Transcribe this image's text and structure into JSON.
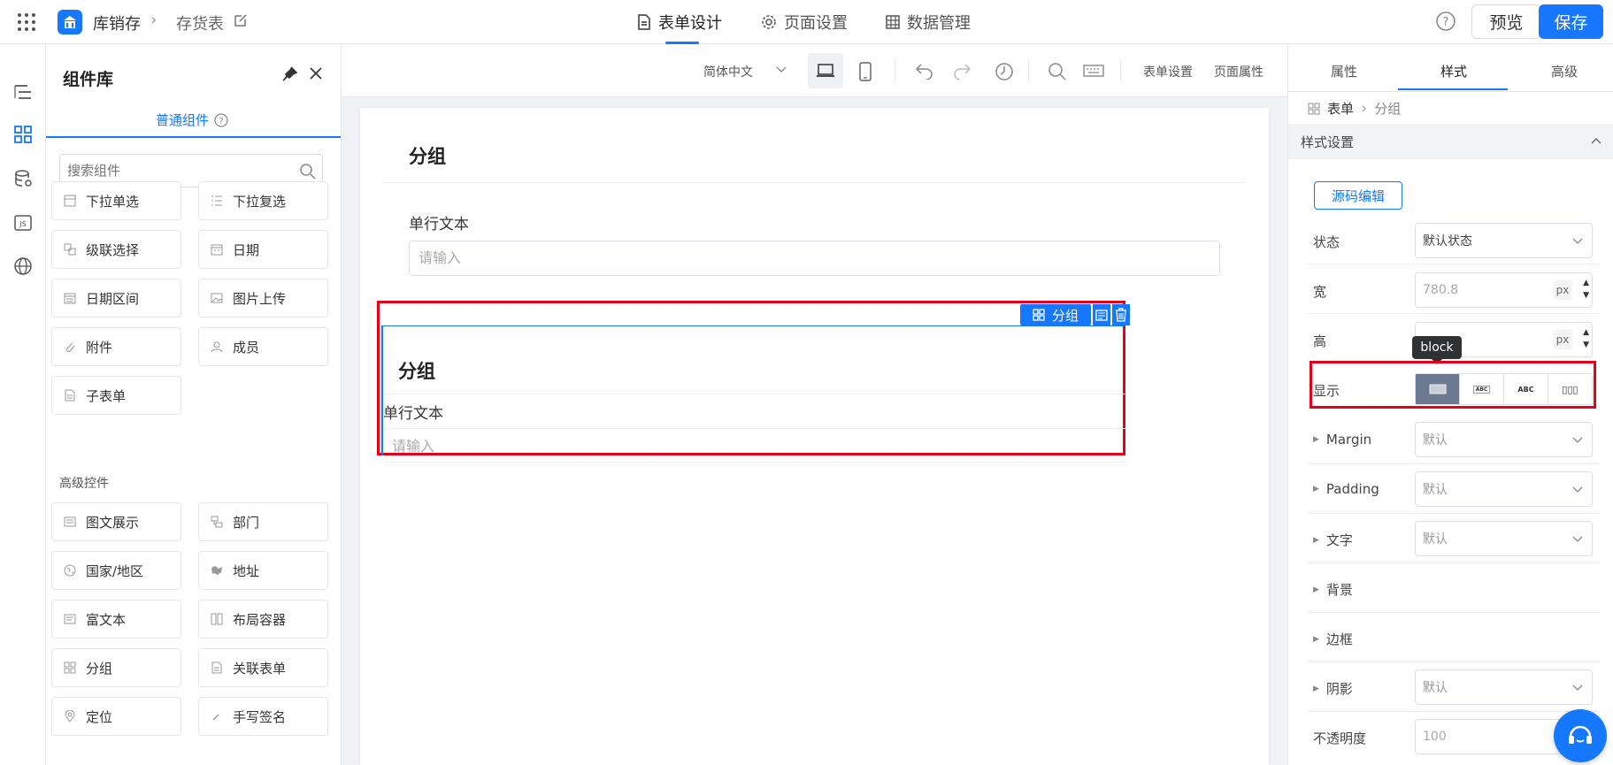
{
  "header": {
    "app_name": "库销存",
    "page_name": "存货表",
    "tabs": [
      {
        "label": "表单设计"
      },
      {
        "label": "页面设置"
      },
      {
        "label": "数据管理"
      }
    ],
    "preview_label": "预览",
    "save_label": "保存"
  },
  "component_library": {
    "title": "组件库",
    "tab_label": "普通组件",
    "search_placeholder": "搜索组件",
    "basic_components": [
      {
        "label": "下拉单选",
        "icon": "dropdown-icon"
      },
      {
        "label": "下拉复选",
        "icon": "checklist-icon"
      },
      {
        "label": "级联选择",
        "icon": "cascade-icon"
      },
      {
        "label": "日期",
        "icon": "calendar-icon"
      },
      {
        "label": "日期区间",
        "icon": "calendar-range-icon"
      },
      {
        "label": "图片上传",
        "icon": "image-icon"
      },
      {
        "label": "附件",
        "icon": "paperclip-icon"
      },
      {
        "label": "成员",
        "icon": "user-icon"
      },
      {
        "label": "子表单",
        "icon": "subform-icon"
      }
    ],
    "advanced_title": "高级控件",
    "advanced_components": [
      {
        "label": "图文展示",
        "icon": "richcard-icon"
      },
      {
        "label": "部门",
        "icon": "org-icon"
      },
      {
        "label": "国家/地区",
        "icon": "globe-icon"
      },
      {
        "label": "地址",
        "icon": "map-icon"
      },
      {
        "label": "富文本",
        "icon": "richtext-icon"
      },
      {
        "label": "布局容器",
        "icon": "layout-icon"
      },
      {
        "label": "分组",
        "icon": "group-icon"
      },
      {
        "label": "关联表单",
        "icon": "linked-form-icon"
      },
      {
        "label": "定位",
        "icon": "location-icon"
      },
      {
        "label": "手写签名",
        "icon": "signature-icon"
      }
    ]
  },
  "toolbar": {
    "language": "简体中文",
    "form_settings": "表单设置",
    "page_props": "页面属性"
  },
  "canvas": {
    "group_title": "分组",
    "field_label": "单行文本",
    "field_placeholder": "请输入",
    "selected": {
      "badge": "分组",
      "group_title": "分组",
      "field_label": "单行文本",
      "field_placeholder": "请输入"
    }
  },
  "right_panel": {
    "tabs": [
      {
        "label": "属性"
      },
      {
        "label": "样式"
      },
      {
        "label": "高级"
      }
    ],
    "breadcrumb": {
      "root": "表单",
      "current": "分组"
    },
    "section_title": "样式设置",
    "source_edit": "源码编辑",
    "state": {
      "label": "状态",
      "value": "默认状态"
    },
    "width": {
      "label": "宽",
      "value": "780.8",
      "unit": "px"
    },
    "height": {
      "label": "高",
      "unit": "px"
    },
    "display": {
      "label": "显示",
      "tooltip": "block",
      "options": [
        "",
        "ABC",
        "ABC",
        "▯▯▯"
      ]
    },
    "margin": {
      "label": "Margin",
      "value": "默认"
    },
    "padding": {
      "label": "Padding",
      "value": "默认"
    },
    "text": {
      "label": "文字",
      "value": "默认"
    },
    "background": {
      "label": "背景"
    },
    "border": {
      "label": "边框"
    },
    "shadow": {
      "label": "阴影",
      "value": "默认"
    },
    "opacity": {
      "label": "不透明度",
      "value": "100"
    }
  },
  "colors": {
    "accent": "#1677ff",
    "highlight": "#e6001a"
  }
}
